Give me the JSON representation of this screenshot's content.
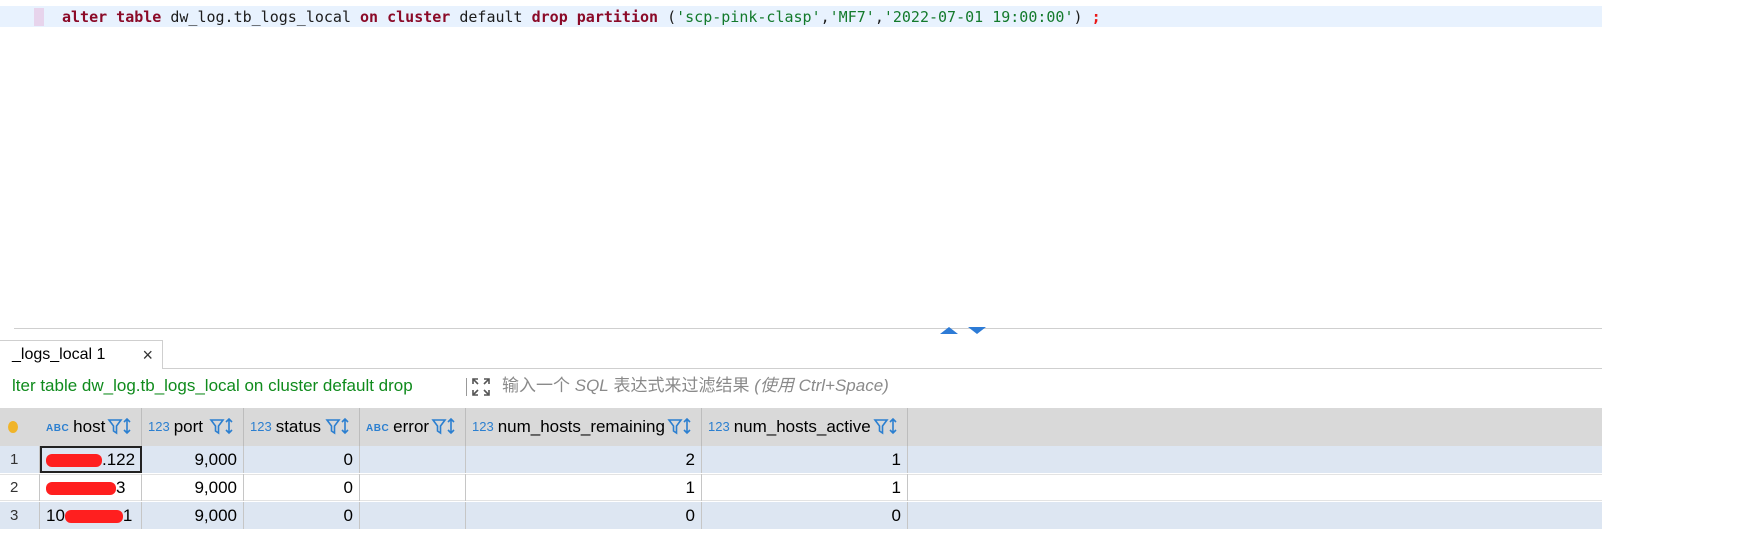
{
  "editor": {
    "tokens": [
      {
        "text": "alter table",
        "kind": "kw"
      },
      {
        "text": " dw_log.tb_logs_local ",
        "kind": "plain"
      },
      {
        "text": "on cluster",
        "kind": "kw"
      },
      {
        "text": " default ",
        "kind": "plain"
      },
      {
        "text": "drop partition",
        "kind": "kw"
      },
      {
        "text": " (",
        "kind": "plain"
      },
      {
        "text": "'scp-pink-clasp'",
        "kind": "str"
      },
      {
        "text": ",",
        "kind": "plain"
      },
      {
        "text": "'MF7'",
        "kind": "str"
      },
      {
        "text": ",",
        "kind": "plain"
      },
      {
        "text": "'2022-07-01 19:00:00'",
        "kind": "str"
      },
      {
        "text": ") ",
        "kind": "plain"
      },
      {
        "text": ";",
        "kind": "semi"
      }
    ]
  },
  "results": {
    "tab_label": "_logs_local 1",
    "tab_close": "×",
    "query_snippet": "lter table dw_log.tb_logs_local on cluster default drop",
    "filter_placeholder_pre": "输入一个 ",
    "filter_placeholder_sql": "SQL",
    "filter_placeholder_mid": " 表达式来过滤结果 ",
    "filter_placeholder_hint": "(使用 Ctrl+Space)",
    "columns": [
      {
        "name": "host",
        "type": "ABC"
      },
      {
        "name": "port",
        "type": "123"
      },
      {
        "name": "status",
        "type": "123"
      },
      {
        "name": "error",
        "type": "ABC"
      },
      {
        "name": "num_hosts_remaining",
        "type": "123"
      },
      {
        "name": "num_hosts_active",
        "type": "123"
      }
    ],
    "rows": [
      {
        "num": "1",
        "host": ".122",
        "port": "9,000",
        "status": "0",
        "error": "",
        "num_hosts_remaining": "2",
        "num_hosts_active": "1"
      },
      {
        "num": "2",
        "host": "3",
        "port": "9,000",
        "status": "0",
        "error": "",
        "num_hosts_remaining": "1",
        "num_hosts_active": "1"
      },
      {
        "num": "3",
        "host_prefix": "10",
        "host": "1",
        "port": "9,000",
        "status": "0",
        "error": "",
        "num_hosts_remaining": "0",
        "num_hosts_active": "0"
      }
    ]
  },
  "colors": {
    "keyword": "#8b0a28",
    "string": "#137a2c",
    "accent": "#2b7fd0",
    "redaction": "#ff1f1f"
  }
}
